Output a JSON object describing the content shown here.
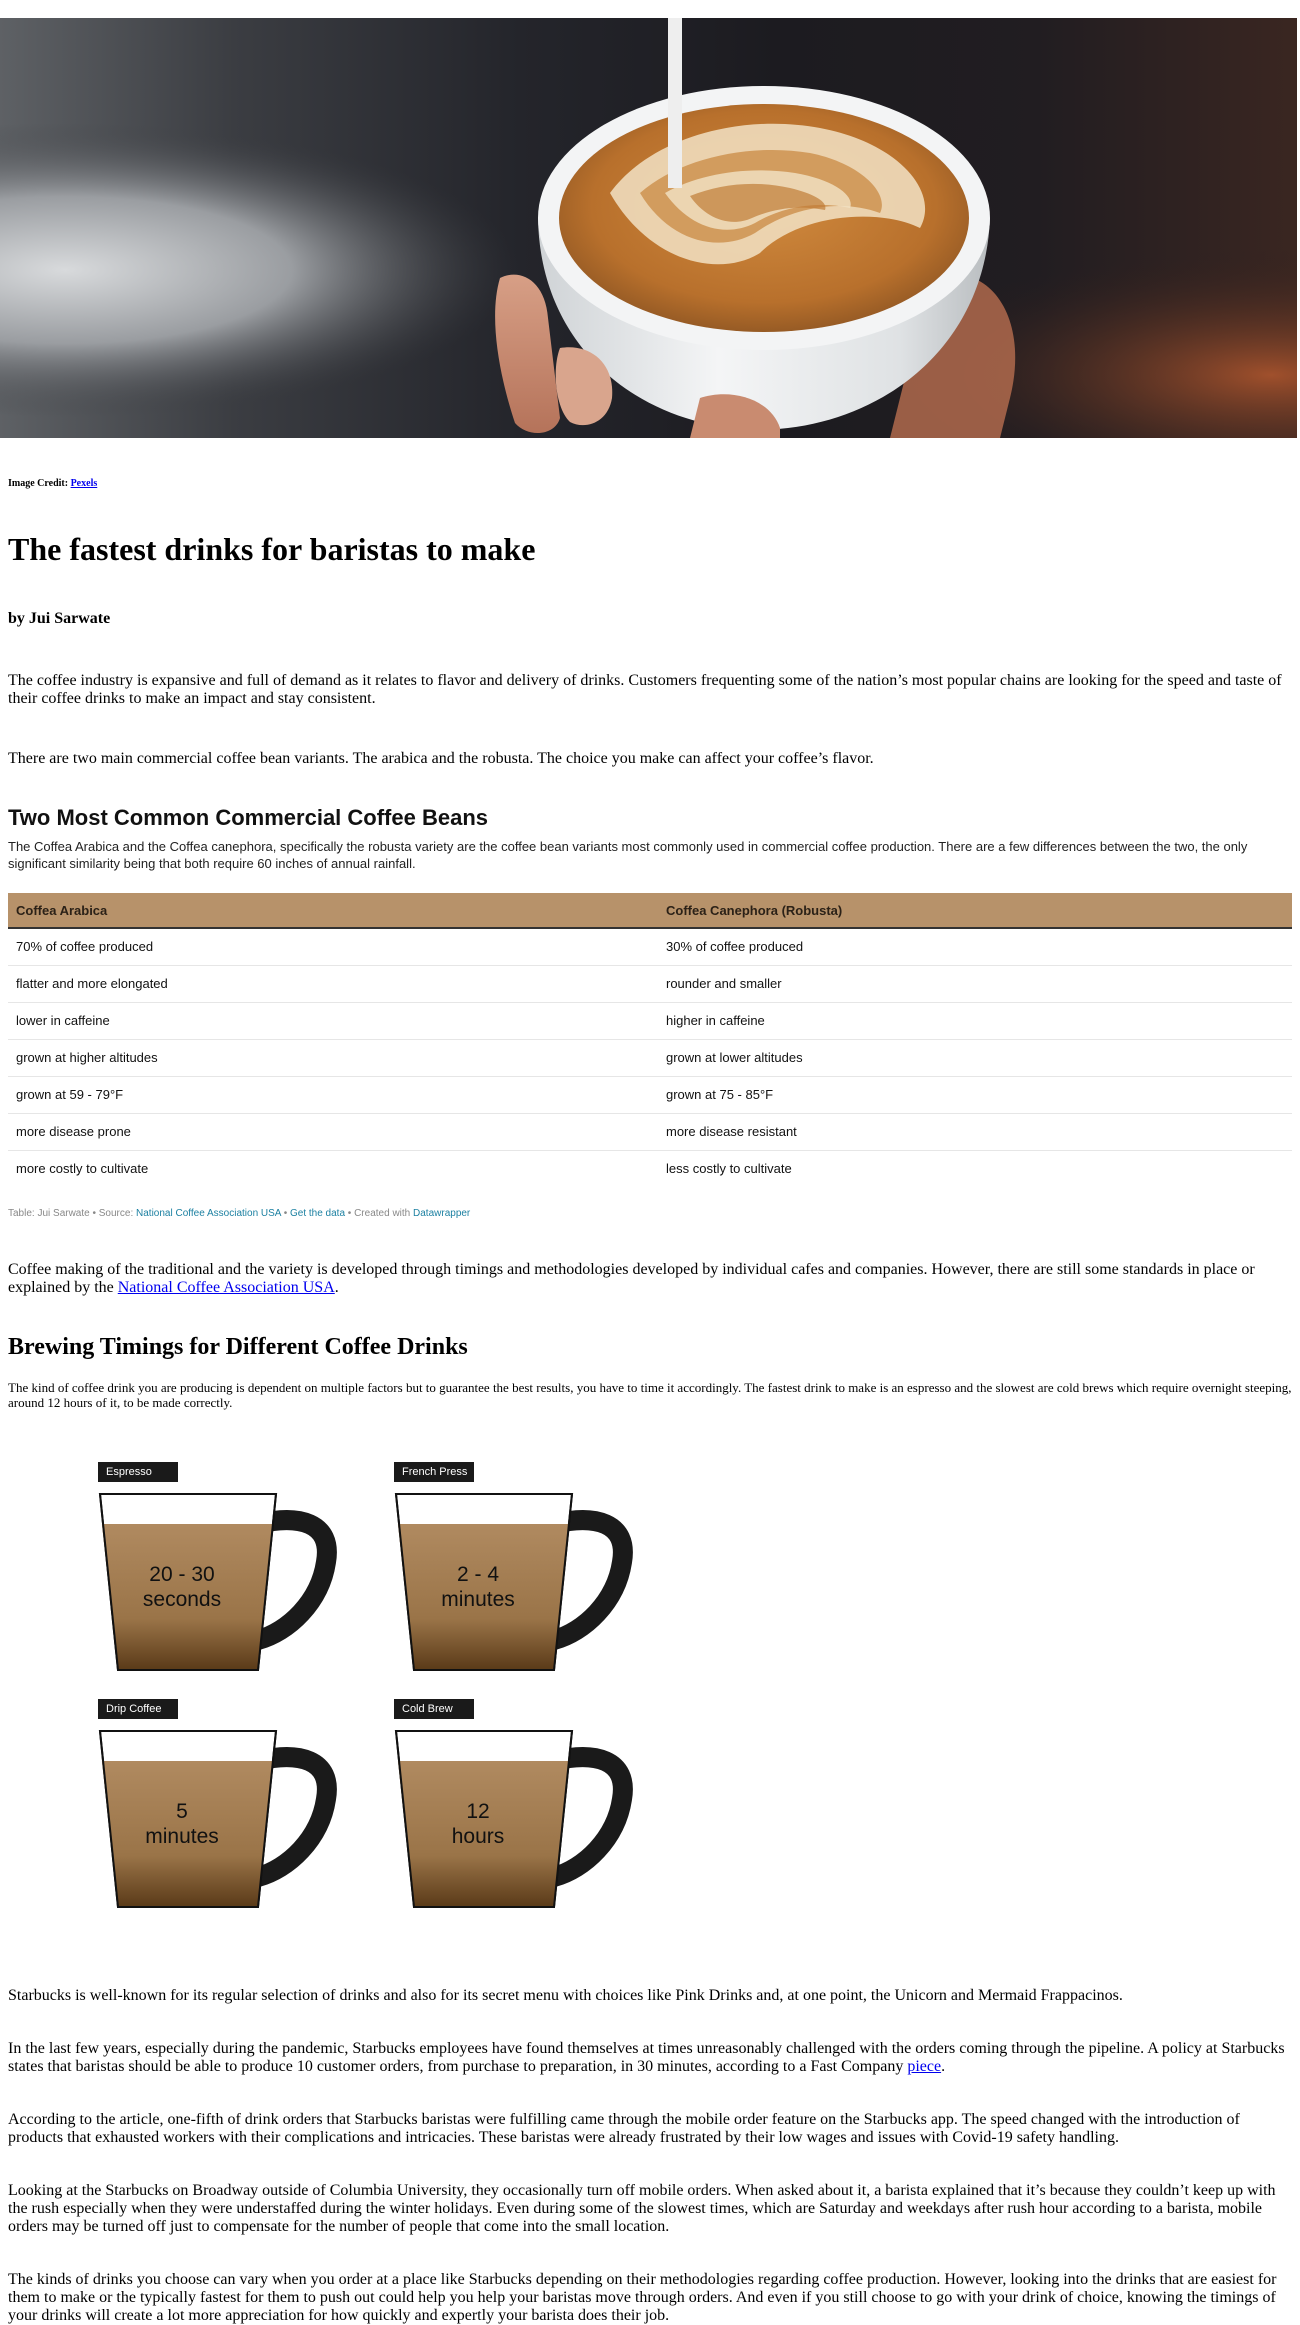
{
  "hero": {
    "alt_icon": "latte-art-photo"
  },
  "credit": {
    "label": "Image Credit:",
    "link_text": "Pexels"
  },
  "title": "The fastest drinks for baristas to make",
  "byline": "by Jui Sarwate",
  "paragraphs": {
    "p1": "The coffee industry is expansive and full of demand as it relates to flavor and delivery of drinks. Customers frequenting some of the nation’s most popular chains are looking for the speed and taste of their coffee drinks to make an impact and stay consistent.",
    "p2": "There are two main commercial coffee bean variants. The arabica and the robusta. The choice you make can affect your coffee’s flavor.",
    "p3_before": "Coffee making of the traditional and the variety is developed through timings and methodologies developed by individual cafes and companies. However, there are still some standards in place or explained by the ",
    "p3_link": "National Coffee Association USA",
    "p3_after": ".",
    "p4": "Starbucks is well-known for its regular selection of drinks and also for its secret menu with choices like Pink Drinks and, at one point, the Unicorn and Mermaid Frappacinos.",
    "p5_before": "In the last few years, especially during the pandemic, Starbucks employees have found themselves at times unreasonably challenged with the orders coming through the pipeline. A policy at Starbucks states that baristas should be able to produce 10 customer orders, from purchase to preparation, in 30 minutes, according to a Fast Company ",
    "p5_link": "piece",
    "p5_after": ".",
    "p6": "According to the article, one-fifth of drink orders that Starbucks baristas were fulfilling came through the mobile order feature on the Starbucks app. The speed changed with the introduction of products that exhausted workers with their complications and intricacies. These baristas were already frustrated by their low wages and issues with Covid-19 safety handling.",
    "p7": "Looking at the Starbucks on Broadway outside of Columbia University, they occasionally turn off mobile orders. When asked about it, a barista explained that it’s because they couldn’t keep up with the rush especially when they were understaffed during the winter holidays. Even during some of the slowest times, which are Saturday and weekdays after rush hour according to a barista, mobile orders may be turned off just to compensate for the number of people that come into the small location.",
    "p8": "The kinds of drinks you choose can vary when you order at a place like Starbucks depending on their methodologies regarding coffee production. However, looking into the drinks that are easiest for them to make or the typically fastest for them to push out could help you help your baristas move through orders. And even if you still choose to go with your drink of choice, knowing the timings of your drinks will create a lot more appreciation for how quickly and expertly your barista does their job."
  },
  "beans_table": {
    "title": "Two Most Common Commercial Coffee Beans",
    "description": "The Coffea Arabica and the Coffea canephora, specifically the robusta variety are the coffee bean variants most commonly used in commercial coffee production. There are a few differences between the two, the only significant similarity being that both require 60 inches of annual rainfall.",
    "header_color": "#b7926a",
    "columns": [
      "Coffea Arabica",
      "Coffea Canephora (Robusta)"
    ],
    "rows": [
      [
        "70% of coffee produced",
        "30% of coffee produced"
      ],
      [
        "flatter and more elongated",
        "rounder and smaller"
      ],
      [
        "lower in caffeine",
        "higher in caffeine"
      ],
      [
        "grown at higher altitudes",
        "grown at lower altitudes"
      ],
      [
        "grown at 59 - 79°F",
        "grown at 75 - 85°F"
      ],
      [
        "more disease prone",
        "more disease resistant"
      ],
      [
        "more costly to cultivate",
        "less costly to cultivate"
      ]
    ],
    "notes": {
      "prefix": "Table: Jui Sarwate • Source: ",
      "source_link": "National Coffee Association USA",
      "sep1": " • ",
      "data_link": "Get the data",
      "sep2": " • Created with ",
      "tool_link": "Datawrapper"
    }
  },
  "brewing": {
    "title": "Brewing Timings for Different Coffee Drinks",
    "description": "The kind of coffee drink you are producing is dependent on multiple factors but to guarantee the best results, you have to time it accordingly. The fastest drink to make is an espresso and the slowest are cold brews which require overnight steeping, around 12 hours of it, to be made correctly.",
    "drinks": [
      {
        "name": "Espresso",
        "time_line1": "20 - 30",
        "time_line2": "seconds"
      },
      {
        "name": "French Press",
        "time_line1": "2 - 4",
        "time_line2": "minutes"
      },
      {
        "name": "Drip Coffee",
        "time_line1": "5",
        "time_line2": "minutes"
      },
      {
        "name": "Cold Brew",
        "time_line1": "12",
        "time_line2": "hours"
      }
    ]
  }
}
